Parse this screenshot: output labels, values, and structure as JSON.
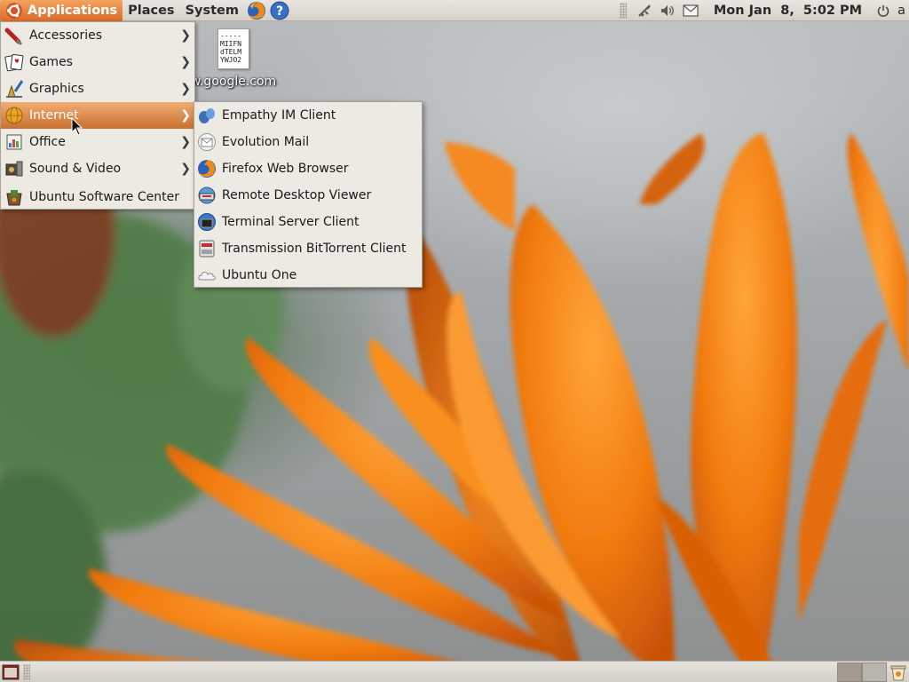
{
  "top_panel": {
    "menus": [
      "Applications",
      "Places",
      "System"
    ],
    "launchers": [
      "firefox-icon",
      "help-icon"
    ],
    "clock": "Mon Jan  8,  5:02 PM",
    "user": "a"
  },
  "desktop": {
    "file_icon_text": "-----\nMIIFN\ndTELM\nYWJO2",
    "file_label": "w.google.com"
  },
  "applications_menu": {
    "items": [
      {
        "label": "Accessories",
        "icon": "accessories-icon",
        "submenu": true
      },
      {
        "label": "Games",
        "icon": "games-icon",
        "submenu": true
      },
      {
        "label": "Graphics",
        "icon": "graphics-icon",
        "submenu": true
      },
      {
        "label": "Internet",
        "icon": "internet-icon",
        "submenu": true,
        "highlighted": true
      },
      {
        "label": "Office",
        "icon": "office-icon",
        "submenu": true
      },
      {
        "label": "Sound & Video",
        "icon": "sound-video-icon",
        "submenu": true
      },
      {
        "label": "Ubuntu Software Center",
        "icon": "software-center-icon",
        "submenu": false
      }
    ]
  },
  "internet_submenu": {
    "items": [
      {
        "label": "Empathy IM Client",
        "icon": "empathy-icon"
      },
      {
        "label": "Evolution Mail",
        "icon": "evolution-mail-icon"
      },
      {
        "label": "Firefox Web Browser",
        "icon": "firefox-icon"
      },
      {
        "label": "Remote Desktop Viewer",
        "icon": "remote-desktop-icon"
      },
      {
        "label": "Terminal Server Client",
        "icon": "terminal-server-icon"
      },
      {
        "label": "Transmission BitTorrent Client",
        "icon": "transmission-icon"
      },
      {
        "label": "Ubuntu One",
        "icon": "ubuntu-one-icon"
      }
    ]
  },
  "bottom_panel": {
    "workspaces": 2,
    "active_workspace": 1
  },
  "colors": {
    "panel": "#dedad3",
    "menu_bg": "#ede9e3",
    "highlight": "#d8793a",
    "wallpaper_orange": "#f07a12"
  }
}
